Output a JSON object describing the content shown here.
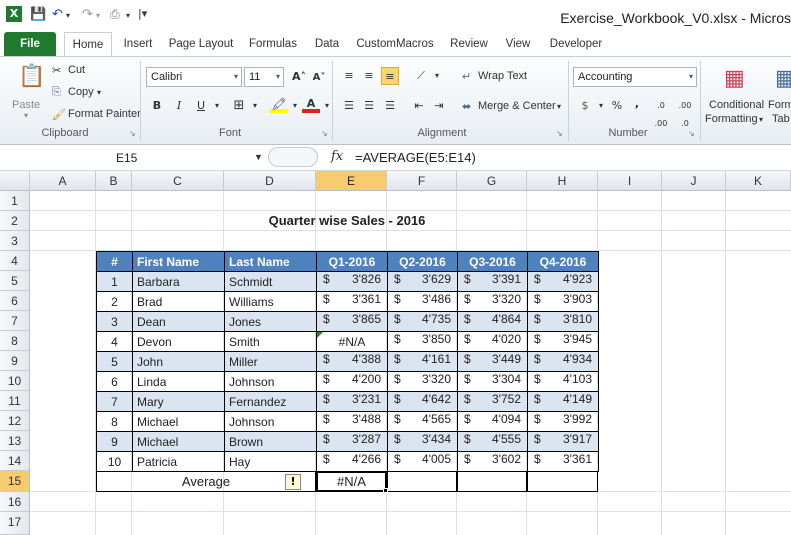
{
  "app": {
    "window_title": "Exercise_Workbook_V0.xlsx - Micros",
    "quick_access": [
      "excel-logo-icon",
      "save-icon",
      "undo-icon",
      "redo-icon",
      "customize-icon"
    ]
  },
  "ribbon": {
    "tabs": [
      "File",
      "Home",
      "Insert",
      "Page Layout",
      "Formulas",
      "Data",
      "CustomMacros",
      "Review",
      "View",
      "Developer"
    ],
    "active_tab": "Home",
    "clipboard": {
      "paste": "Paste",
      "cut": "Cut",
      "copy": "Copy",
      "format_painter": "Format Painter",
      "label": "Clipboard"
    },
    "font": {
      "name": "Calibri",
      "size": "11",
      "label": "Font",
      "bold": "B",
      "italic": "I",
      "underline": "U"
    },
    "alignment": {
      "wrap_text": "Wrap Text",
      "merge_center": "Merge & Center",
      "label": "Alignment"
    },
    "number": {
      "format": "Accounting",
      "currency_symbol": "$",
      "percent": "%",
      "comma": ",",
      "inc_dec": ".0 .00",
      "dec_dec": ".00 .0",
      "label": "Number"
    },
    "styles": {
      "conditional": "Conditional",
      "formatting": "Formatting",
      "format_as": "Form",
      "table": "Tab"
    }
  },
  "formula_bar": {
    "name_box": "E15",
    "fx": "fx",
    "formula": "=AVERAGE(E5:E14)"
  },
  "grid": {
    "columns": [
      "A",
      "B",
      "C",
      "D",
      "E",
      "F",
      "G",
      "H",
      "I",
      "J",
      "K"
    ],
    "rows": [
      "1",
      "2",
      "3",
      "4",
      "5",
      "6",
      "7",
      "8",
      "9",
      "10",
      "11",
      "12",
      "13",
      "14",
      "15",
      "16",
      "17"
    ],
    "active_column": "E",
    "active_row": "15"
  },
  "sheet": {
    "title": "Quarter wise Sales - 2016",
    "headers": [
      "#",
      "First Name",
      "Last Name",
      "Q1-2016",
      "Q2-2016",
      "Q3-2016",
      "Q4-2016"
    ],
    "currency": "$",
    "rows": [
      [
        "1",
        "Barbara",
        "Schmidt",
        "3'826",
        "3'629",
        "3'391",
        "4'923"
      ],
      [
        "2",
        "Brad",
        "Williams",
        "3'361",
        "3'486",
        "3'320",
        "3'903"
      ],
      [
        "3",
        "Dean",
        "Jones",
        "3'865",
        "4'735",
        "4'864",
        "3'810"
      ],
      [
        "4",
        "Devon",
        "Smith",
        "#N/A",
        "3'850",
        "4'020",
        "3'945"
      ],
      [
        "5",
        "John",
        "Miller",
        "4'388",
        "4'161",
        "3'449",
        "4'934"
      ],
      [
        "6",
        "Linda",
        "Johnson",
        "4'200",
        "3'320",
        "3'304",
        "4'103"
      ],
      [
        "7",
        "Mary",
        "Fernandez",
        "3'231",
        "4'642",
        "3'752",
        "4'149"
      ],
      [
        "8",
        "Michael",
        "Johnson",
        "3'488",
        "4'565",
        "4'094",
        "3'992"
      ],
      [
        "9",
        "Michael",
        "Brown",
        "3'287",
        "3'434",
        "4'555",
        "3'917"
      ],
      [
        "10",
        "Patricia",
        "Hay",
        "4'266",
        "4'005",
        "3'602",
        "3'361"
      ]
    ],
    "average_label": "Average",
    "average_value": "#N/A",
    "warning_icon": "error-warning-icon"
  },
  "colors": {
    "header_blue": "#4f81bd",
    "band": "#dbe5f1",
    "file_tab": "#1f7a2e",
    "active_header": "#f8cb6e"
  }
}
